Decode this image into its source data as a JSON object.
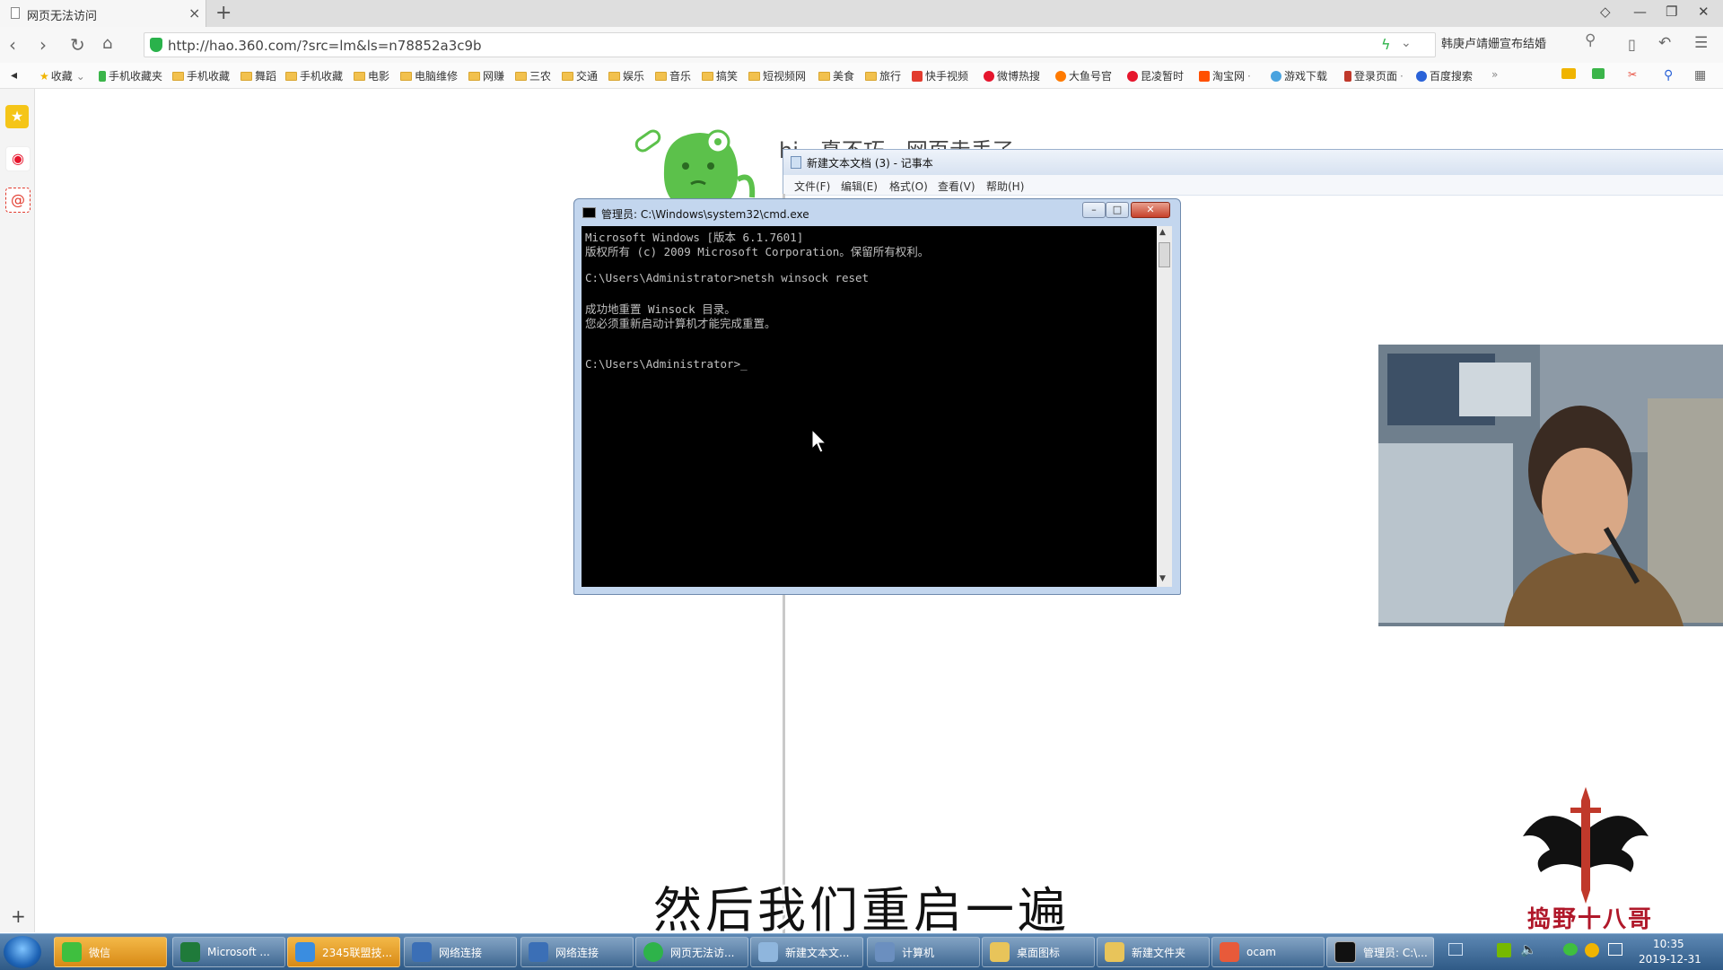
{
  "browser": {
    "tab_title": "网页无法访问",
    "url": "http://hao.360.com/?src=lm&ls=n78852a3c9b",
    "hot_search": "韩庚卢靖姗宣布结婚",
    "bookmarks": [
      "收藏",
      "手机收藏夹",
      "手机收藏",
      "舞蹈",
      "手机收藏",
      "电影",
      "电脑维修",
      "网赚",
      "三农",
      "交通",
      "娱乐",
      "音乐",
      "搞笑",
      "短视频网",
      "美食",
      "旅行",
      "快手视频",
      "微博热搜",
      "大鱼号官",
      "昆凌暂时",
      "淘宝网",
      "游戏下载",
      "登录页面",
      "百度搜索"
    ],
    "more_bookmarks": "»"
  },
  "error_page": {
    "headline": "hi，真不巧，网页走丢了"
  },
  "notepad": {
    "title": "新建文本文档 (3) - 记事本",
    "menu": [
      "文件(F)",
      "编辑(E)",
      "格式(O)",
      "查看(V)",
      "帮助(H)"
    ]
  },
  "cmd": {
    "title": "管理员: C:\\Windows\\system32\\cmd.exe",
    "lines": [
      "Microsoft Windows [版本 6.1.7601]",
      "版权所有 (c) 2009 Microsoft Corporation。保留所有权利。",
      "",
      "C:\\Users\\Administrator>netsh winsock reset",
      "",
      "成功地重置 Winsock 目录。",
      "您必须重新启动计算机才能完成重置。",
      "",
      "",
      "C:\\Users\\Administrator>_"
    ]
  },
  "subtitle": "然后我们重启一遍",
  "watermark": "捣野十八哥",
  "taskbar": {
    "items": [
      {
        "label": "微信",
        "color": "#3fbf3f"
      },
      {
        "label": "Microsoft ...",
        "color": "#1f7a3a"
      },
      {
        "label": "2345联盟技...",
        "color": "#3a8de0"
      },
      {
        "label": "网络连接",
        "color": "#3b6fb6"
      },
      {
        "label": "网络连接",
        "color": "#3b6fb6"
      },
      {
        "label": "网页无法访...",
        "color": "#2eb34a"
      },
      {
        "label": "新建文本文...",
        "color": "#8fb6dd"
      },
      {
        "label": "计算机",
        "color": "#6b8fbf"
      },
      {
        "label": "桌面图标",
        "color": "#e8c45a"
      },
      {
        "label": "新建文件夹",
        "color": "#e8c45a"
      },
      {
        "label": "ocam",
        "color": "#e85a3a"
      },
      {
        "label": "管理员: C:\\...",
        "color": "#111111"
      }
    ],
    "time": "10:35",
    "date": "2019-12-31"
  }
}
